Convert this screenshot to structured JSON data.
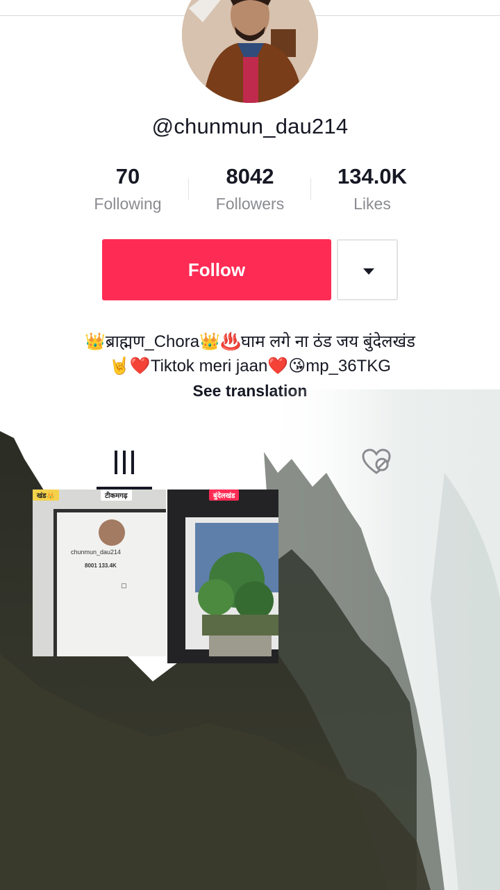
{
  "profile": {
    "username": "@chunmun_dau214"
  },
  "stats": [
    {
      "value": "70",
      "label": "Following"
    },
    {
      "value": "8042",
      "label": "Followers"
    },
    {
      "value": "134.0K",
      "label": "Likes"
    }
  ],
  "actions": {
    "follow_label": "Follow",
    "more_icon": "caret-down-icon"
  },
  "bio": {
    "line1": "👑ब्राह्मण_Chora👑♨️घाम लगे ना ठंड  जय बुंदेलखंड",
    "line2": "🤘❤️Tiktok meri jaan❤️😘mp_36TKG",
    "see_translation": "See translation"
  },
  "tabs": {
    "videos_icon": "grid-icon",
    "liked_icon": "hidden-heart-icon"
  },
  "thumbnails": [
    {
      "badge_left": "खंड👑",
      "badge_right": "टीकमगढ़",
      "mini_username": "chunmun_dau214",
      "mini_stats": "8001    133.4K"
    },
    {
      "badge_top": "बुंदेलखंड"
    }
  ],
  "colors": {
    "accent": "#fe2c55",
    "text_primary": "#161823",
    "text_secondary": "#8a8b91"
  }
}
